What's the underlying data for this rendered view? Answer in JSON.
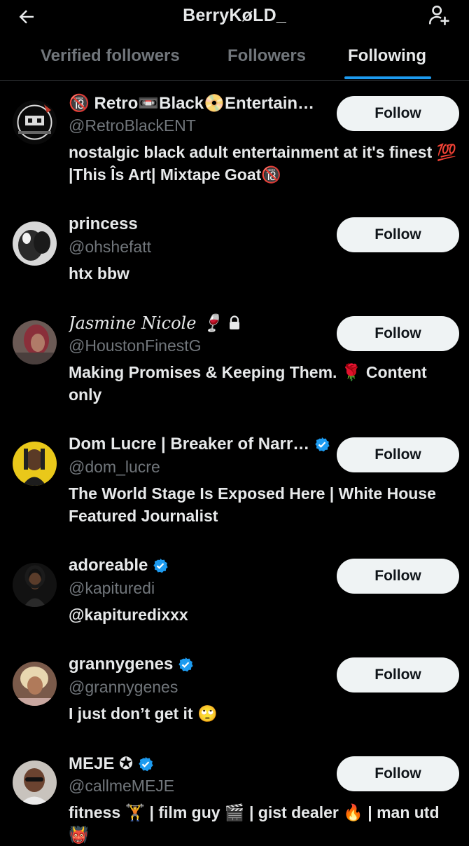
{
  "header": {
    "title": "BerryKøLD_",
    "back_icon": "arrow-left-icon",
    "add_icon": "add-user-icon"
  },
  "tabs": [
    {
      "label": "Verified followers",
      "active": false
    },
    {
      "label": "Followers",
      "active": false
    },
    {
      "label": "Following",
      "active": true
    }
  ],
  "colors": {
    "accent": "#1d9bf0",
    "verified": "#1d9bf0",
    "background": "#000000",
    "muted": "#71767b",
    "button_bg": "#eff3f4"
  },
  "users": [
    {
      "name": "🔞 Retro📼Black📀Entertain…",
      "handle": "@RetroBlackENT",
      "bio": "nostalgic black adult entertainment at it's finest 💯 |This Îs Art| Mixtape Goat🔞",
      "verified": false,
      "button": "Follow"
    },
    {
      "name": "princess",
      "handle": "@ohshefatt",
      "bio": "htx bbw",
      "verified": false,
      "button": "Follow"
    },
    {
      "name": "Jasmine Nicole 🍷",
      "handle": "@HoustonFinestG",
      "bio": "Making Promises & Keeping Them. 🌹 Content only",
      "verified": false,
      "locked": true,
      "button": "Follow"
    },
    {
      "name": "Dom Lucre | Breaker of Narr…",
      "handle": "@dom_lucre",
      "bio": "The World Stage Is Exposed Here | White House Featured Journalist",
      "verified": true,
      "button": "Follow"
    },
    {
      "name": "adoreable",
      "handle": "@kapituredi",
      "bio": "@kapituredixxx",
      "verified": true,
      "button": "Follow"
    },
    {
      "name": "grannygenes",
      "handle": "@grannygenes",
      "bio": "I just don’t get it 🙄",
      "verified": true,
      "button": "Follow"
    },
    {
      "name": "MEJE ✪",
      "handle": "@callmeMEJE",
      "bio": "fitness 🏋 | film guy 🎬 | gist dealer 🔥 | man utd 👹",
      "verified": true,
      "button": "Follow"
    }
  ]
}
